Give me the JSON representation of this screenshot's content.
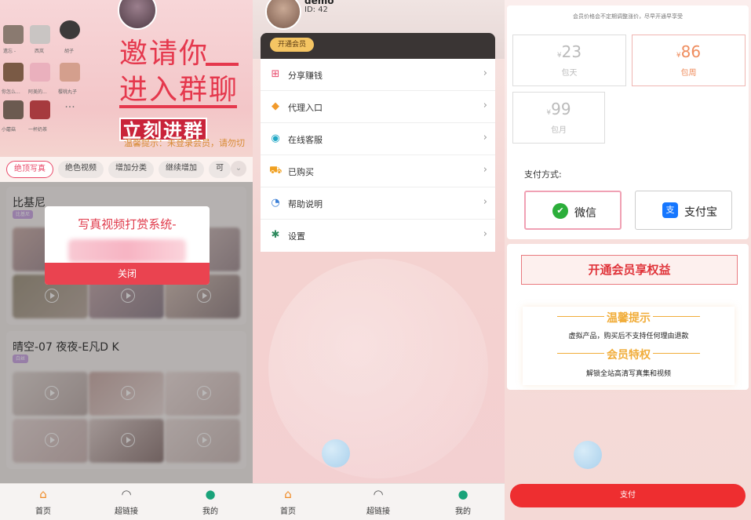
{
  "panel1": {
    "grid_names": [
      "遗忘 -",
      "西岚",
      "胡子",
      "你怎么...",
      "阿美的...",
      "樱桃丸子",
      "小蘑菇",
      "一杯奶茶"
    ],
    "invite_line1": "邀请你",
    "invite_line2": "进入群聊",
    "join_label": "立刻进群",
    "tip": "温馨提示：未登录会员，请勿切",
    "tabs": [
      "绝顶写真",
      "绝色视频",
      "增加分类",
      "继续增加",
      "可"
    ],
    "cards": [
      {
        "title": "比基尼",
        "badge": "比基尼"
      },
      {
        "title": "晴空-07 夜夜-E凡D K",
        "badge": "白丝"
      }
    ],
    "modal": {
      "title": "写真视频打赏系统-",
      "close_label": "关闭"
    }
  },
  "nav": {
    "home": "首页",
    "links": "超链接",
    "mine": "我的"
  },
  "panel2": {
    "user_name": "demo",
    "user_id": "ID: 42",
    "vip_label": "开通会员",
    "menu": [
      {
        "label": "分享赚钱",
        "icon": "gift-icon"
      },
      {
        "label": "代理入口",
        "icon": "agent-icon"
      },
      {
        "label": "在线客服",
        "icon": "chat-icon"
      },
      {
        "label": "已购买",
        "icon": "cart-icon"
      },
      {
        "label": "帮助说明",
        "icon": "help-icon"
      },
      {
        "label": "设置",
        "icon": "gear-icon"
      }
    ]
  },
  "panel3": {
    "notice": "会员价格会不定期调整涨价，尽早开通早享受",
    "currency": "¥",
    "prices": [
      {
        "amount": "23",
        "label": "包天",
        "selected": false
      },
      {
        "amount": "86",
        "label": "包周",
        "selected": true
      },
      {
        "amount": "99",
        "label": "包月",
        "selected": false
      }
    ],
    "pay_title": "支付方式:",
    "wechat": "微信",
    "alipay": "支付宝",
    "open_label": "开通会员享权益",
    "tips_head": "温馨提示",
    "tips_text": "虚拟产品，购买后不支持任何理由退款",
    "rights_head": "会员特权",
    "rights_text": "解锁全站高清写真集和视频",
    "submit": "支付"
  },
  "colors": {
    "accent": "#ee2e30",
    "gold": "#f1ad3a",
    "brand_pink": "#e94868"
  }
}
